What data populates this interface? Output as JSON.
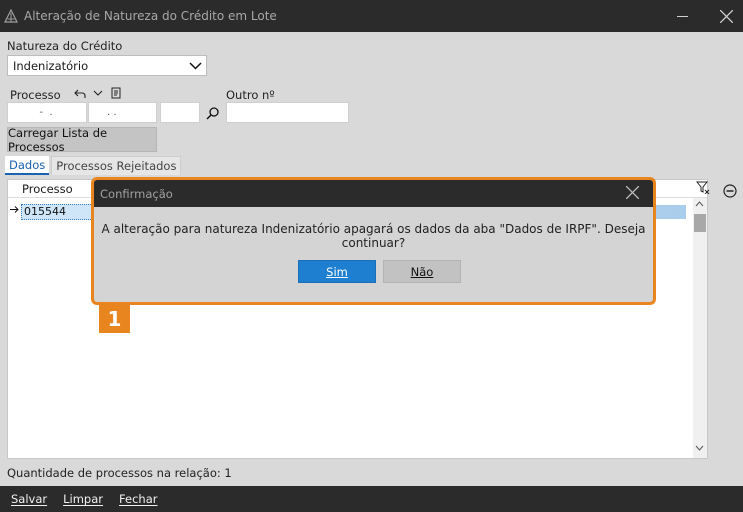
{
  "window": {
    "title": "Alteração de Natureza do Crédito em Lote",
    "app_icon": "app-logo-icon",
    "minimize_icon": "minimize-icon",
    "close_icon": "close-icon"
  },
  "form": {
    "natureza_label": "Natureza do Crédito",
    "natureza_value": "Indenizatório",
    "processo_label": "Processo",
    "processo_part1": "  -  .",
    "processo_part2": ". .",
    "processo_part3": "",
    "outro_label": "Outro nº",
    "outro_value": "",
    "load_button": "Carregar Lista de Processos"
  },
  "tabs": [
    {
      "label": "Dados",
      "active": true
    },
    {
      "label": "Processos Rejeitados",
      "active": false
    }
  ],
  "grid": {
    "column_header": "Processo",
    "rows": [
      {
        "processo": "015544"
      }
    ]
  },
  "status": {
    "count_text": "Quantidade de processos na relação: 1"
  },
  "footer": {
    "salvar": "Salvar",
    "limpar": "Limpar",
    "fechar": "Fechar"
  },
  "dialog": {
    "title": "Confirmação",
    "message": "A alteração para natureza Indenizatório apagará os dados da aba \"Dados de IRPF\". Deseja continuar?",
    "yes_label": "Sim",
    "no_label": "Não"
  },
  "badge": {
    "number": "1",
    "color": "#e8851f"
  },
  "colors": {
    "accent": "#1e7fd0",
    "highlight": "#e8851f",
    "titlebar": "#2b2b2b"
  }
}
